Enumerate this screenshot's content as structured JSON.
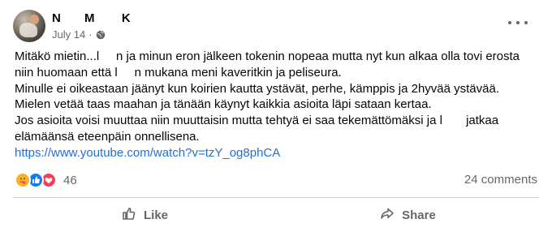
{
  "post": {
    "author": "N       M        K",
    "date": "July 14",
    "separator": "·",
    "privacy_icon": "globe-icon",
    "menu_icon": "more-options-icon",
    "lines": [
      "Mitäkö mietin...l     n ja minun eron jälkeen tokenin nopeaa mutta nyt kun alkaa olla tovi erosta",
      "niin huomaan että l     n mukana meni kaveritkin ja peliseura.",
      "Minulle ei oikeastaan jäänyt kun koirien kautta ystävät, perhe, kämppis ja 2hyvää ystävää.",
      "Mielen vetää taas maahan ja tänään käynyt kaikkia asioita läpi sataan kertaa.",
      "Jos asioita voisi muuttaa niin muuttaisin mutta tehtyä ei saa tekemättömäksi ja l       jatkaa",
      "elämäänsä eteenpäin onnellisena."
    ],
    "link": "https://www.youtube.com/watch?v=tzY_og8phCA"
  },
  "stats": {
    "reaction_icons": [
      "care-emoji-icon",
      "like-reaction-icon",
      "love-reaction-icon"
    ],
    "reaction_count": "46",
    "comments": "24 comments"
  },
  "actions": {
    "like_label": "Like",
    "share_label": "Share"
  },
  "colors": {
    "link": "#216fdb",
    "muted": "#65676b",
    "like_blue": "#1877f2",
    "love_red": "#f33e58",
    "care_yellow": "#f7b125"
  }
}
